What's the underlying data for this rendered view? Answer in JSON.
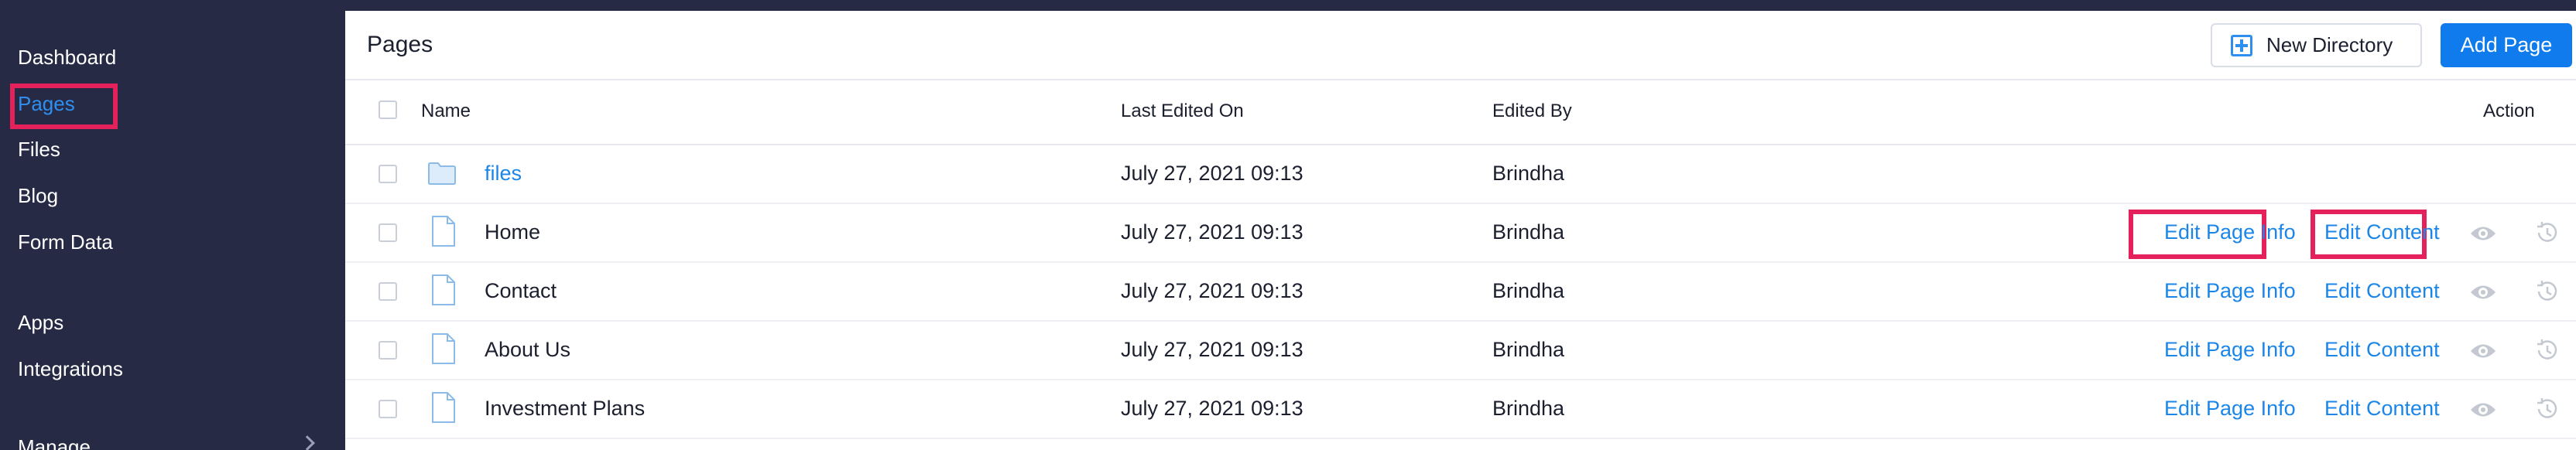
{
  "sidebar": {
    "items": [
      {
        "label": "Dashboard"
      },
      {
        "label": "Pages"
      },
      {
        "label": "Files"
      },
      {
        "label": "Blog"
      },
      {
        "label": "Form Data"
      },
      {
        "label": "Apps"
      },
      {
        "label": "Integrations"
      },
      {
        "label": "Manage"
      }
    ],
    "active_item": "Pages"
  },
  "header": {
    "title": "Pages",
    "new_directory_label": "New Directory",
    "add_page_label": "Add Page"
  },
  "table": {
    "columns": {
      "name": "Name",
      "last_edited_on": "Last Edited On",
      "edited_by": "Edited By",
      "action": "Action"
    },
    "rows": [
      {
        "type": "folder",
        "name": "files",
        "last_edited_on": "July 27, 2021 09:13",
        "edited_by": "Brindha"
      },
      {
        "type": "page",
        "name": "Home",
        "last_edited_on": "July 27, 2021 09:13",
        "edited_by": "Brindha",
        "edit_info_label": "Edit Page Info",
        "edit_content_label": "Edit Content"
      },
      {
        "type": "page",
        "name": "Contact",
        "last_edited_on": "July 27, 2021 09:13",
        "edited_by": "Brindha",
        "edit_info_label": "Edit Page Info",
        "edit_content_label": "Edit Content"
      },
      {
        "type": "page",
        "name": "About Us",
        "last_edited_on": "July 27, 2021 09:13",
        "edited_by": "Brindha",
        "edit_info_label": "Edit Page Info",
        "edit_content_label": "Edit Content"
      },
      {
        "type": "page",
        "name": "Investment Plans",
        "last_edited_on": "July 27, 2021 09:13",
        "edited_by": "Brindha",
        "edit_info_label": "Edit Page Info",
        "edit_content_label": "Edit Content"
      }
    ]
  },
  "icons": {
    "folder": "folder-icon",
    "page": "page-icon",
    "preview": "eye-icon",
    "revert": "restore-icon",
    "new_directory": "plus-square-icon",
    "expand": "chevron-right-icon"
  },
  "colors": {
    "sidebar_bg": "#262a44",
    "accent": "#0f7bec",
    "link": "#1b86e8",
    "highlight": "#e5215b"
  }
}
